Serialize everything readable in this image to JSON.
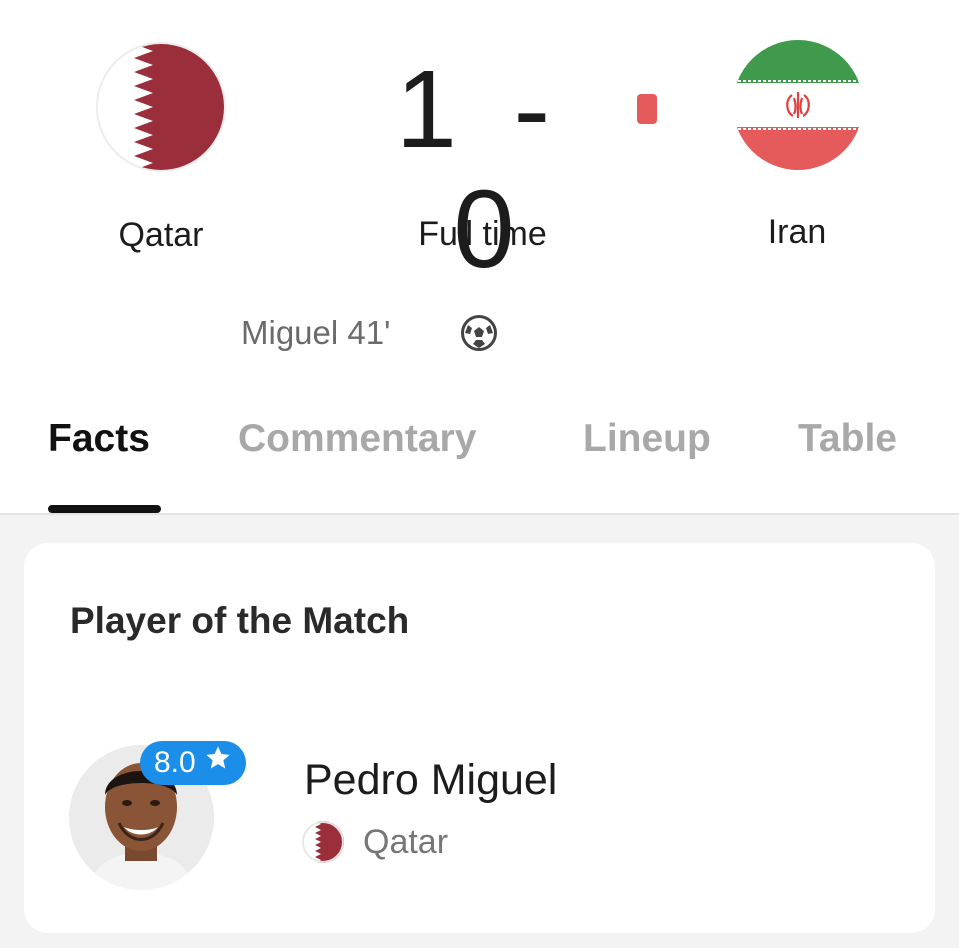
{
  "match": {
    "home_team": "Qatar",
    "away_team": "Iran",
    "home_score": "1",
    "separator": "-",
    "away_score": "0",
    "status": "Full time",
    "scorer": "Miguel 41'"
  },
  "tabs": [
    {
      "label": "Facts",
      "active": true
    },
    {
      "label": "Commentary",
      "active": false
    },
    {
      "label": "Lineup",
      "active": false
    },
    {
      "label": "Table",
      "active": false
    }
  ],
  "player_of_match": {
    "title": "Player of the Match",
    "name": "Pedro Miguel",
    "team": "Qatar",
    "rating": "8.0"
  },
  "icons": {
    "live_indicator": "live-dot-icon",
    "goal": "soccer-ball-icon",
    "rating": "star-icon"
  },
  "colors": {
    "live": "#e55a5a",
    "rating_badge": "#1a8ee8",
    "qatar_maroon": "#8d1b3d",
    "iran_green": "#239f40",
    "iran_red": "#da0000"
  }
}
